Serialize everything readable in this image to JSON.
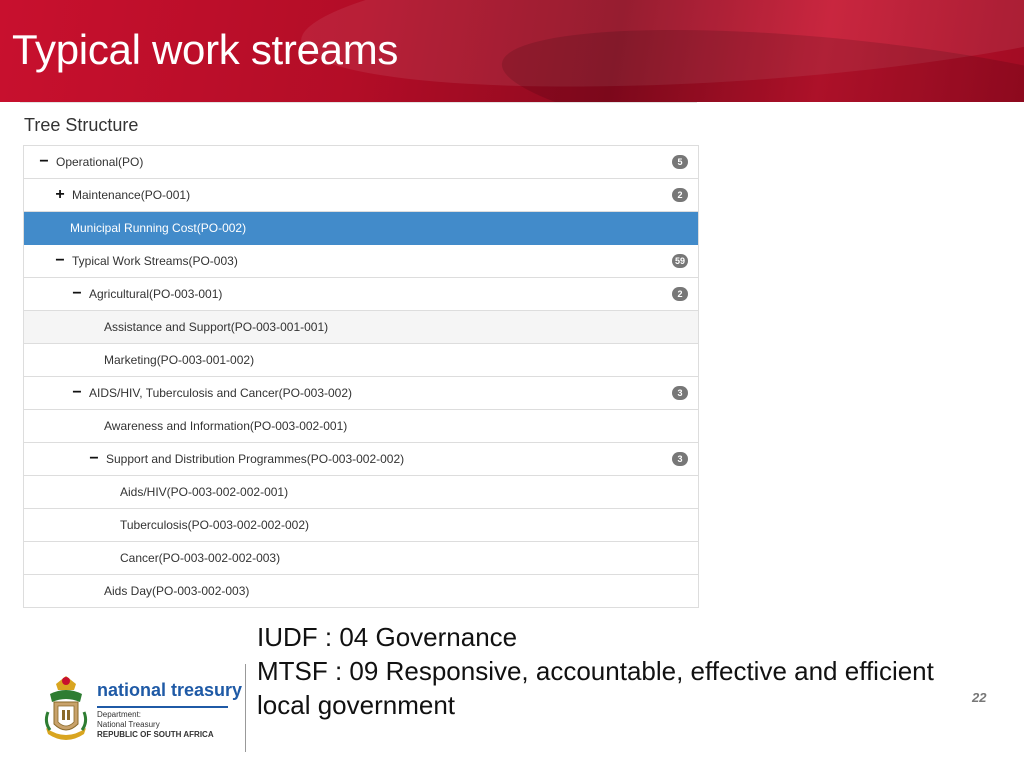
{
  "slide": {
    "title": "Typical work streams",
    "page_number": "22"
  },
  "panel": {
    "heading": "Tree Structure"
  },
  "tree": {
    "nodes": [
      {
        "label": "Operational(PO)",
        "toggle": "−",
        "badge": "5",
        "level": 0,
        "state": "normal"
      },
      {
        "label": "Maintenance(PO-001)",
        "toggle": "+",
        "badge": "2",
        "level": 1,
        "state": "normal"
      },
      {
        "label": "Municipal Running Cost(PO-002)",
        "toggle": "",
        "badge": "",
        "level": 1,
        "state": "selected"
      },
      {
        "label": "Typical Work Streams(PO-003)",
        "toggle": "−",
        "badge": "59",
        "level": 1,
        "state": "normal"
      },
      {
        "label": "Agricultural(PO-003-001)",
        "toggle": "−",
        "badge": "2",
        "level": 2,
        "state": "normal"
      },
      {
        "label": "Assistance and Support(PO-003-001-001)",
        "toggle": "",
        "badge": "",
        "level": 3,
        "state": "hover"
      },
      {
        "label": "Marketing(PO-003-001-002)",
        "toggle": "",
        "badge": "",
        "level": 3,
        "state": "normal"
      },
      {
        "label": "AIDS/HIV, Tuberculosis and Cancer(PO-003-002)",
        "toggle": "−",
        "badge": "3",
        "level": 2,
        "state": "normal"
      },
      {
        "label": "Awareness and Information(PO-003-002-001)",
        "toggle": "",
        "badge": "",
        "level": 3,
        "state": "normal"
      },
      {
        "label": "Support and Distribution Programmes(PO-003-002-002)",
        "toggle": "−",
        "badge": "3",
        "level": 3,
        "state": "normal"
      },
      {
        "label": "Aids/HIV(PO-003-002-002-001)",
        "toggle": "",
        "badge": "",
        "level": 4,
        "state": "normal"
      },
      {
        "label": "Tuberculosis(PO-003-002-002-002)",
        "toggle": "",
        "badge": "",
        "level": 4,
        "state": "normal"
      },
      {
        "label": "Cancer(PO-003-002-002-003)",
        "toggle": "",
        "badge": "",
        "level": 4,
        "state": "normal"
      },
      {
        "label": "Aids Day(PO-003-002-003)",
        "toggle": "",
        "badge": "",
        "level": 3,
        "state": "normal"
      }
    ]
  },
  "footer": {
    "line1": "IUDF : 04 Governance",
    "line2": "MTSF : 09 Responsive, accountable, effective and efficient",
    "line3": "local government"
  },
  "logo": {
    "name": "national treasury",
    "sub1": "Department:",
    "sub2": "National Treasury",
    "sub3": "REPUBLIC OF SOUTH AFRICA"
  },
  "colors": {
    "banner": "#c8102e",
    "selected_row": "#428bca",
    "badge": "#777777",
    "logo_blue": "#1f5aa6"
  }
}
